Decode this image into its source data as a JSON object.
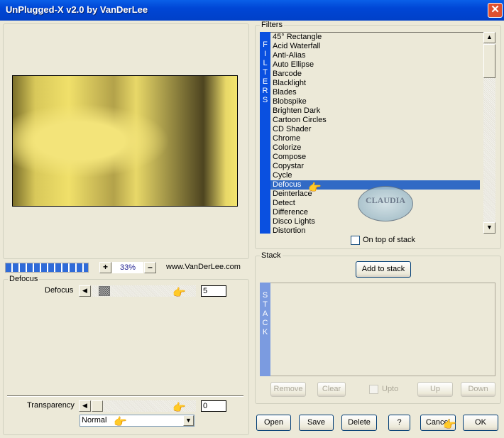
{
  "window": {
    "title": "UnPlugged-X v2.0 by VanDerLee",
    "close_icon": "close-icon"
  },
  "preview": {
    "zoom": "33%",
    "plus": "+",
    "minus": "–",
    "website": "www.VanDerLee.com",
    "progress": 1.0
  },
  "params": {
    "group_label": "Defocus",
    "defocus_label": "Defocus",
    "defocus_value": "5",
    "transparency_label": "Transparency",
    "transparency_value": "0",
    "blend_mode": "Normal"
  },
  "filters": {
    "group_label": "Filters",
    "vertical_label": [
      "F",
      "I",
      "L",
      "T",
      "E",
      "R",
      "S"
    ],
    "items": [
      "45° Rectangle",
      "Acid Waterfall",
      "Anti-Alias",
      "Auto Ellipse",
      "Barcode",
      "Blacklight",
      "Blades",
      "Blobspike",
      "Brighten Dark",
      "Cartoon Circles",
      "CD Shader",
      "Chrome",
      "Colorize",
      "Compose",
      "Copystar",
      "Cycle",
      "Defocus",
      "Deinterlace",
      "Detect",
      "Difference",
      "Disco Lights",
      "Distortion"
    ],
    "selected": "Defocus",
    "on_top_label": "On top of stack",
    "on_top_checked": false,
    "watermark": "CLAUDIA"
  },
  "stack": {
    "group_label": "Stack",
    "add_label": "Add to stack",
    "vertical_label": [
      "S",
      "T",
      "A",
      "C",
      "K"
    ],
    "remove": "Remove",
    "clear": "Clear",
    "upto": "Upto",
    "up": "Up",
    "down": "Down"
  },
  "footer": {
    "open": "Open",
    "save": "Save",
    "delete": "Delete",
    "help": "?",
    "cancel": "Cancel",
    "ok": "OK"
  },
  "colors": {
    "title_bar": "#0046d5",
    "selection": "#316ac5",
    "filters_bar": "#0a50e0",
    "stack_bar": "#7b9be0"
  }
}
